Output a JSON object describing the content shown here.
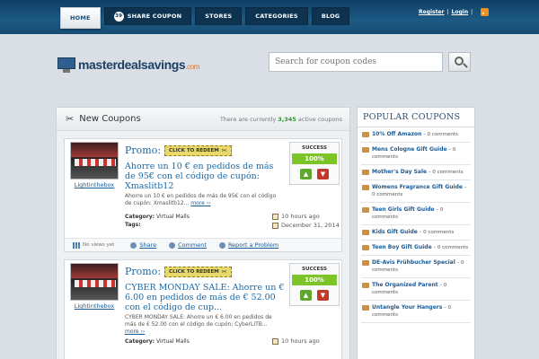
{
  "nav": {
    "home": "HOME",
    "share_number": "39",
    "share_coupon": "SHARE COUPON",
    "stores": "STORES",
    "categories": "CATEGORIES",
    "blog": "BLOG"
  },
  "toplinks": {
    "register": "Register",
    "sep": "|",
    "login": "Login",
    "sep2": "|"
  },
  "logo": {
    "main": "masterdealsavings",
    "suffix": ".com"
  },
  "search": {
    "placeholder": "Search for coupon codes"
  },
  "main": {
    "title": "New Coupons",
    "count_prefix": "There are currently ",
    "count": "3,345",
    "count_suffix": " active coupons"
  },
  "coupons": [
    {
      "store": "Lightinthebox",
      "promo_label": "Promo:",
      "redeem_label": "CLICK TO REDEEM",
      "title": "Ahorre un 10 € en pedidos de más de 95€ con el código de cupón: Xmaslitb12",
      "description": "Ahorre un 10 € en pedidos de más de 95€ con el código de cupón: Xmaslitb12...",
      "more": "more ››",
      "category_label": "Category:",
      "category": "Virtual Malls",
      "tags_label": "Tags:",
      "time": "10 hours ago",
      "expires": "December 31, 2014",
      "success_label": "SUCCESS",
      "success_rate": "100%",
      "views": "No views yet",
      "share": "Share",
      "comment": "Comment",
      "report": "Report a Problem"
    },
    {
      "store": "Lightinthebox",
      "promo_label": "Promo:",
      "redeem_label": "CLICK TO REDEEM",
      "title": "CYBER MONDAY SALE: Ahorre un € 6.00 en pedidos de más de € 52.00 con el código de cup...",
      "description": "CYBER MONDAY SALE: Ahorre un € 6.00 en pedidos de más de € 52.00 con el código de cupón: CyberLITB...",
      "more": "more ››",
      "category_label": "Category:",
      "category": "Virtual Malls",
      "time": "10 hours ago",
      "success_label": "SUCCESS",
      "success_rate": "100%"
    }
  ],
  "sidebar": {
    "title": "POPULAR COUPONS",
    "items": [
      {
        "name": "10% Off Amazon",
        "comments": " – 0 comments"
      },
      {
        "name": "Mens Cologne Gift Guide",
        "comments": " – 0 comments"
      },
      {
        "name": "Mother's Day Sale",
        "comments": " – 0 comments"
      },
      {
        "name": "Womens Fragrance Gift Guide",
        "comments": " – 0 comments"
      },
      {
        "name": "Teen Girls Gift Guide",
        "comments": " – 0 comments"
      },
      {
        "name": "Kids Gift Guide",
        "comments": " – 0 comments"
      },
      {
        "name": "Teen Boy Gift Guide",
        "comments": " – 0 comments"
      },
      {
        "name": "DE-Avis Frühbucher Special",
        "comments": " – 0 comments"
      },
      {
        "name": "The Organized Parent",
        "comments": " – 0 comments"
      },
      {
        "name": "Untangle Your Hangers",
        "comments": " – 0 comments"
      }
    ]
  }
}
